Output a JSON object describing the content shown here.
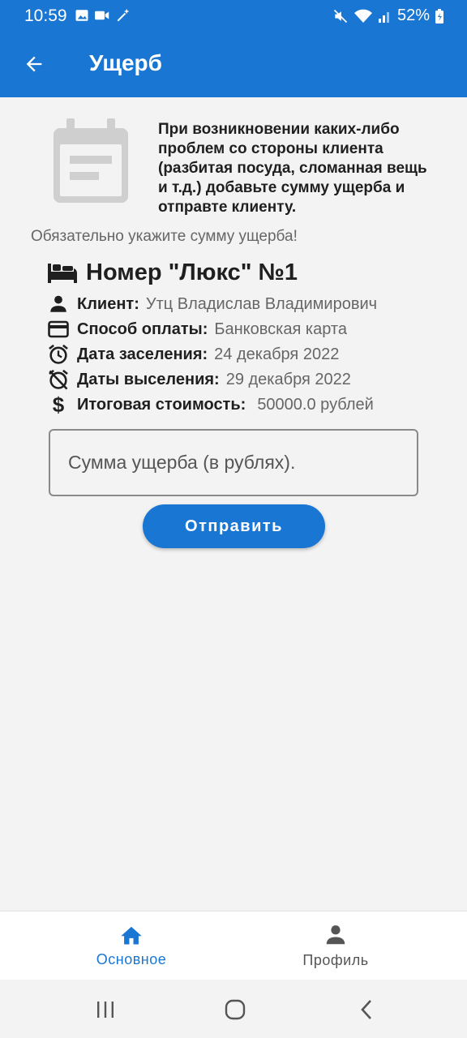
{
  "status_bar": {
    "time": "10:59",
    "battery": "52%"
  },
  "app_bar": {
    "title": "Ущерб"
  },
  "info": {
    "text": "При возникновении каких-либо проблем со стороны клиента (разбитая посуда, сломанная вещь и т.д.) добавьте сумму ущерба и отправте клиенту.",
    "hint": "Обязательно укажите сумму ущерба!"
  },
  "room": {
    "title": "Номер \"Люкс\" №1"
  },
  "details": {
    "client_label": "Клиент:",
    "client_value": "Утц Владислав Владимирович",
    "payment_label": "Способ оплаты:",
    "payment_value": "Банковская карта",
    "checkin_label": "Дата заселения:",
    "checkin_value": "24 декабря 2022",
    "checkout_label": "Даты выселения:",
    "checkout_value": "29 декабря 2022",
    "total_label": "Итоговая стоимость:",
    "total_value": "50000.0 рублей"
  },
  "form": {
    "damage_placeholder": "Сумма ущерба (в рублях).",
    "damage_value": "",
    "send_label": "Отправить"
  },
  "bottom_nav": {
    "home_label": "Основное",
    "profile_label": "Профиль"
  },
  "colors": {
    "primary": "#1976d2",
    "background": "#f3f3f3",
    "active_nav": "#1976d2",
    "inactive_nav": "#555555"
  }
}
